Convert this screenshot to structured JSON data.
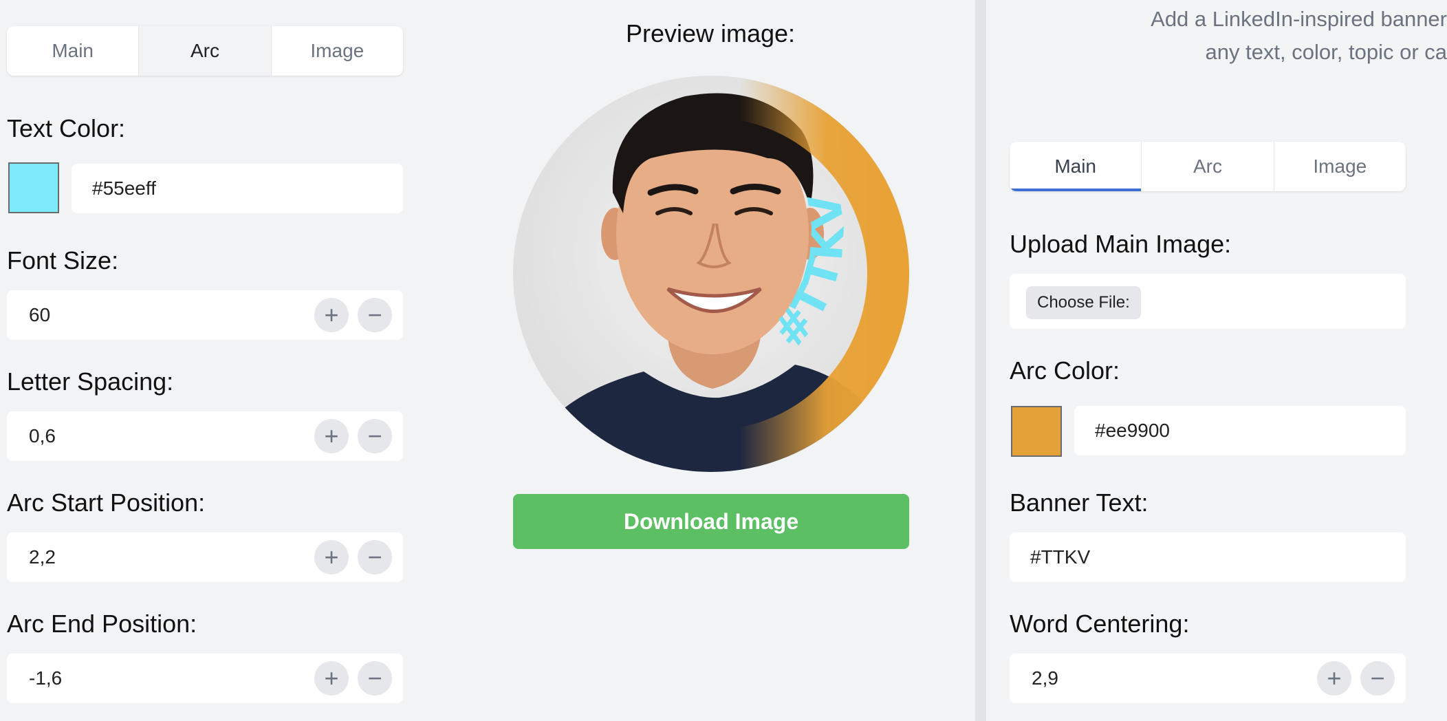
{
  "left_panel": {
    "tabs": [
      "Main",
      "Arc",
      "Image"
    ],
    "active_tab": "Arc",
    "text_color": {
      "label": "Text Color:",
      "value": "#55eeff",
      "swatch": "#7de9fb"
    },
    "font_size": {
      "label": "Font Size:",
      "value": "60"
    },
    "letter_spacing": {
      "label": "Letter Spacing:",
      "value": "0,6"
    },
    "arc_start": {
      "label": "Arc Start Position:",
      "value": "2,2"
    },
    "arc_end": {
      "label": "Arc End Position:",
      "value": "-1,6"
    },
    "stepper_plus": "+",
    "stepper_minus": "−"
  },
  "preview": {
    "title": "Preview image:",
    "banner_text": "#TTKV",
    "arc_color": "#e8a236",
    "text_color": "#6fe2f3",
    "download_label": "Download Image"
  },
  "right_panel": {
    "intro_line1": "Add a LinkedIn-inspired banner",
    "intro_line2": "any text, color, topic or ca",
    "tabs": [
      "Main",
      "Arc",
      "Image"
    ],
    "active_tab": "Main",
    "upload": {
      "label": "Upload Main Image:",
      "button": "Choose File:"
    },
    "arc_color": {
      "label": "Arc Color:",
      "value": "#ee9900",
      "swatch": "#e4a039"
    },
    "banner_text": {
      "label": "Banner Text:",
      "value": "#TTKV"
    },
    "word_centering": {
      "label": "Word Centering:",
      "value": "2,9"
    },
    "stepper_plus": "+",
    "stepper_minus": "−"
  }
}
